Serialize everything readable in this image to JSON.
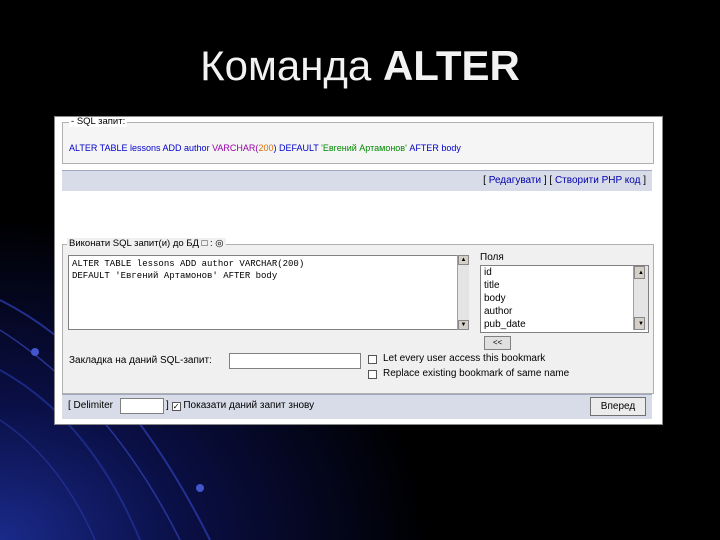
{
  "slide": {
    "title_regular": "Команда",
    "title_bold": "ALTER"
  },
  "pma": {
    "sql_query_legend": "SQL запит",
    "sql": {
      "p1": "ALTER TABLE lessons ADD author",
      "p2": "VARCHAR(",
      "p3": "200",
      "p4": ") DEFAULT",
      "p5": "'Евгений Артамонов'",
      "p6": "AFTER body"
    },
    "links": {
      "edit": "Редагувати",
      "create_php": "Створити PHP код"
    },
    "run_legend": "Виконати SQL запит(и) до БД",
    "textarea_value": "ALTER TABLE lessons ADD author VARCHAR(200)\nDEFAULT 'Евгений Артамонов' AFTER body",
    "fields_label": "Поля",
    "fields": [
      "id",
      "title",
      "body",
      "author",
      "pub_date"
    ],
    "insert_button": "<<",
    "bookmark_label": "Закладка на даний SQL-запит:",
    "bookmark_value": "",
    "options": {
      "let_every_user": "Let every user access this bookmark",
      "replace_existing": "Replace existing bookmark of same name"
    },
    "delimiter_label": "[ Delimiter",
    "delimiter_value": "",
    "show_query_again": "Показати даний запит знову",
    "go_button": "Вперед",
    "colors": {
      "keyword": "#0000cc",
      "string": "#008800",
      "type": "#9900aa",
      "number": "#d87000"
    }
  }
}
